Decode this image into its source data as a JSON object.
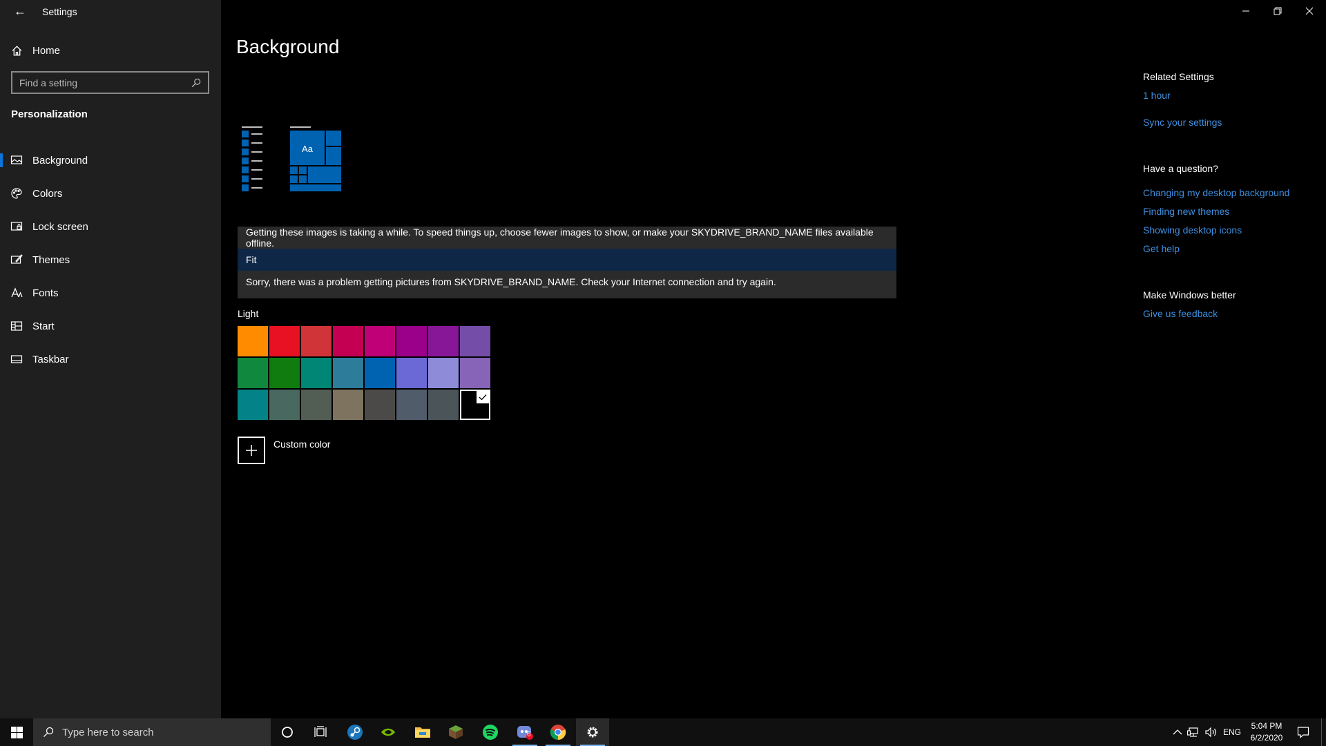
{
  "window": {
    "title": "Settings",
    "back_glyph": "←"
  },
  "sidebar": {
    "home_label": "Home",
    "search_placeholder": "Find a setting",
    "section_label": "Personalization",
    "items": [
      {
        "label": "Background",
        "icon": "image-icon",
        "active": true
      },
      {
        "label": "Colors",
        "icon": "palette-icon",
        "active": false
      },
      {
        "label": "Lock screen",
        "icon": "lock-screen-icon",
        "active": false
      },
      {
        "label": "Themes",
        "icon": "brush-icon",
        "active": false
      },
      {
        "label": "Fonts",
        "icon": "font-icon",
        "active": false
      },
      {
        "label": "Start",
        "icon": "start-icon",
        "active": false
      },
      {
        "label": "Taskbar",
        "icon": "taskbar-icon",
        "active": false
      }
    ]
  },
  "main": {
    "title": "Background",
    "preview_text": "Aa",
    "messages": [
      "Getting these images is taking a while. To speed things up, choose fewer images to show, or make your SKYDRIVE_BRAND_NAME files available offline.",
      "Fit",
      "Sorry, there was a problem getting pictures from SKYDRIVE_BRAND_NAME. Check your Internet connection and try again."
    ],
    "light_label": "Light",
    "swatches": [
      "#ff8c00",
      "#e81123",
      "#d13438",
      "#c30052",
      "#bf0077",
      "#9a0089",
      "#881798",
      "#744da9",
      "#10893e",
      "#107c10",
      "#018574",
      "#2d7d9a",
      "#0063b1",
      "#6b69d6",
      "#8e8cd8",
      "#8764b8",
      "#038387",
      "#486860",
      "#525e54",
      "#7e735f",
      "#4c4a48",
      "#515c6b",
      "#4a5459",
      "#000000"
    ],
    "selected_swatch_index": 23,
    "custom_color_label": "Custom color"
  },
  "right": {
    "related_heading": "Related Settings",
    "related_links": [
      "1 hour",
      "Sync your settings"
    ],
    "question_heading": "Have a question?",
    "question_links": [
      "Changing my desktop background",
      "Finding new themes",
      "Showing desktop icons",
      "Get help"
    ],
    "better_heading": "Make Windows better",
    "better_links": [
      "Give us feedback"
    ]
  },
  "taskbar": {
    "search_placeholder": "Type here to search",
    "discord_badge": "6",
    "lang": "ENG",
    "time": "5:04 PM",
    "date": "6/2/2020"
  },
  "colors": {
    "accent": "#0a74da",
    "link": "#3f8fe0",
    "sidebar_bg": "#1f1f1f"
  }
}
